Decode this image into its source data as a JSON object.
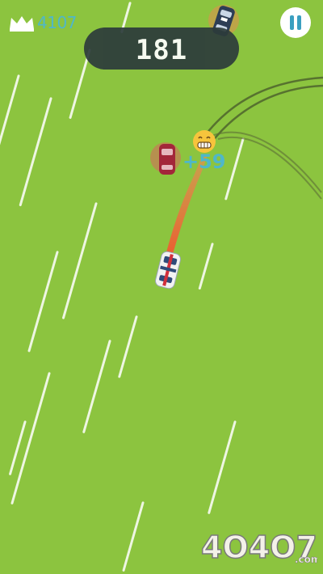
{
  "hud": {
    "best_score": "4107",
    "score": "181",
    "pause_icon": "pause-icon",
    "crown_icon": "crown-icon"
  },
  "popup": {
    "bonus": "+59",
    "emoji_icon": "grinning-face-icon"
  },
  "watermark": {
    "text": "4O4O7",
    "suffix": ".com"
  },
  "colors": {
    "grass": "#8cc43f",
    "score_pill": "#2c3b3b",
    "accent_blue": "#4fb7c9",
    "player_car": "#f2f2f2",
    "enemy_car": "#a3263a",
    "trail": "#ef6a3a"
  }
}
